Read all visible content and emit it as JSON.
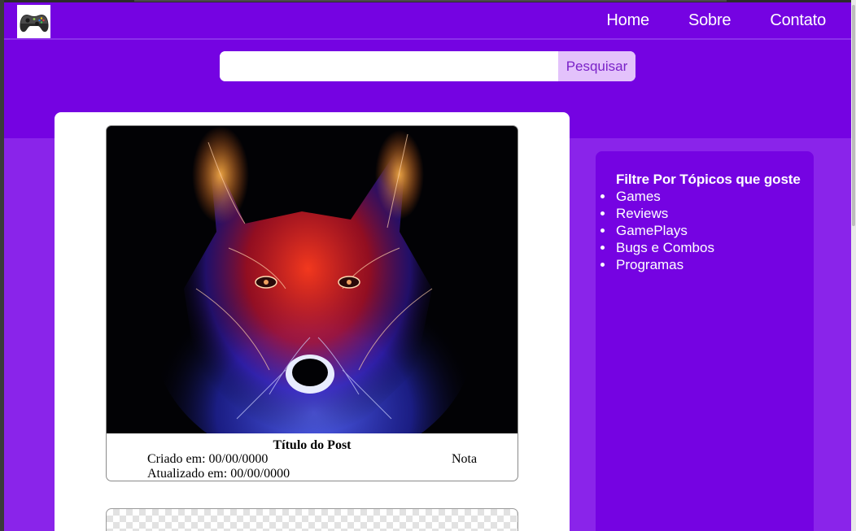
{
  "header": {
    "logo_icon": "gamepad-icon",
    "nav": [
      "Home",
      "Sobre",
      "Contato"
    ],
    "search": {
      "value": "",
      "placeholder": "",
      "button_label": "Pesquisar"
    }
  },
  "posts": [
    {
      "image_icon": "neon-wolf-image",
      "title": "Título do Post",
      "created": "Criado em: 00/00/0000",
      "updated": "Atualizado em: 00/00/0000",
      "rating": "Nota"
    }
  ],
  "sidebar": {
    "heading": "Filtre Por Tópicos que goste",
    "topics": [
      "Games",
      "Reviews",
      "GamePlays",
      "Bugs e Combos",
      "Programas"
    ]
  },
  "colors": {
    "header_bg": "#7503e2",
    "page_bg": "#8a24ea",
    "sidebar_bg": "#7503e2",
    "search_button_bg": "#e3c2fb",
    "search_button_text": "#7a22c8"
  }
}
